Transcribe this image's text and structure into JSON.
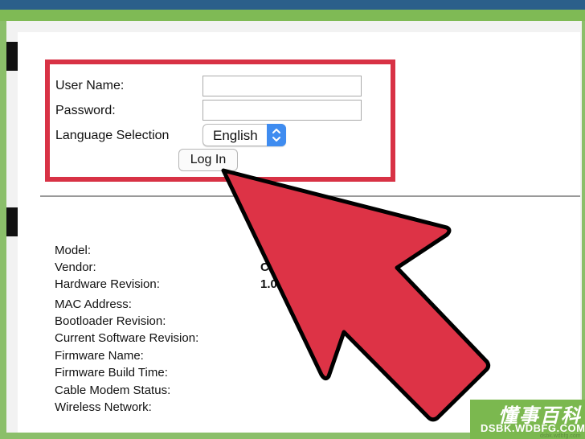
{
  "login": {
    "username_label": "User Name:",
    "password_label": "Password:",
    "language_label": "Language Selection",
    "language_value": "English",
    "login_button": "Log In",
    "username_value": "",
    "password_value": ""
  },
  "info": {
    "labels": [
      "Model:",
      "Vendor:",
      "Hardware Revision:",
      "MAC Address:",
      "Bootloader Revision:",
      "Current Software Revision:",
      "Firmware Name:",
      "Firmware Build Time:",
      "Cable Modem Status:",
      "Wireless Network:"
    ],
    "values": [
      "",
      "C",
      "1.0",
      "",
      "",
      "",
      "",
      "",
      "",
      ""
    ]
  },
  "watermark": {
    "title": "懂事百科",
    "url": "DSBK.WDBFG.COM",
    "small": "dsbk.wdbfg.com"
  },
  "colors": {
    "highlight": "#d83245",
    "arrow": "#dd3346",
    "select_accent": "#3f8cf0",
    "watermark": "#7bb84f"
  },
  "icons": {
    "select_arrow": "up-down-chevron-icon",
    "pointer": "arrow-pointer-icon"
  }
}
